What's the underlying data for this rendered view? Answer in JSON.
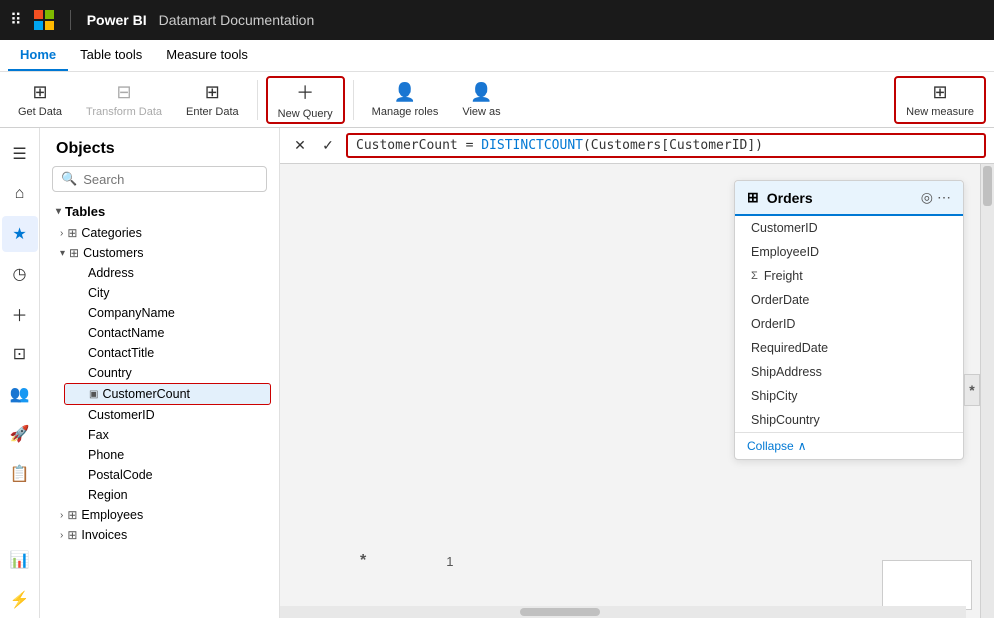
{
  "topbar": {
    "app": "Power BI",
    "title": "Datamart Documentation"
  },
  "ribbon": {
    "tabs": [
      "Home",
      "Table tools",
      "Measure tools"
    ],
    "active_tab": "Home",
    "buttons": [
      {
        "label": "Get Data",
        "icon": "⊞",
        "disabled": false
      },
      {
        "label": "Transform Data",
        "icon": "⊟",
        "disabled": true
      },
      {
        "label": "Enter Data",
        "icon": "⊞",
        "disabled": false
      },
      {
        "label": "New Query",
        "icon": "+",
        "disabled": false,
        "highlighted": true
      },
      {
        "label": "Manage roles",
        "icon": "👤",
        "disabled": false
      },
      {
        "label": "View as",
        "icon": "👤",
        "disabled": false
      },
      {
        "label": "New measure",
        "icon": "⊞",
        "disabled": false,
        "highlighted": true
      }
    ]
  },
  "sidebar": {
    "icons": [
      "≡",
      "🏠",
      "★",
      "◷",
      "+",
      "⊡",
      "👥",
      "🚀",
      "📋",
      "📊",
      "⚡"
    ]
  },
  "objects": {
    "title": "Objects",
    "search_placeholder": "Search",
    "tables_label": "Tables",
    "categories_label": "Categories",
    "customers_label": "Customers",
    "customers_fields": [
      "Address",
      "City",
      "CompanyName",
      "ContactName",
      "ContactTitle",
      "Country"
    ],
    "customer_count_label": "CustomerCount",
    "customers_fields2": [
      "CustomerID",
      "Fax",
      "Phone",
      "PostalCode",
      "Region"
    ],
    "employees_label": "Employees",
    "invoices_label": "Invoices"
  },
  "formula": {
    "expression": "CustomerCount = DISTINCTCOUNT(Customers[CustomerID])"
  },
  "orders_card": {
    "title": "Orders",
    "fields": [
      {
        "name": "CustomerID",
        "sigma": false
      },
      {
        "name": "EmployeeID",
        "sigma": false
      },
      {
        "name": "Freight",
        "sigma": true
      },
      {
        "name": "OrderDate",
        "sigma": false
      },
      {
        "name": "OrderID",
        "sigma": false
      },
      {
        "name": "RequiredDate",
        "sigma": false
      },
      {
        "name": "ShipAddress",
        "sigma": false
      },
      {
        "name": "ShipCity",
        "sigma": false
      },
      {
        "name": "ShipCountry",
        "sigma": false
      }
    ],
    "collapse_label": "Collapse"
  },
  "grid": {
    "asterisk_bottom": "*",
    "number_1": "1",
    "asterisk_side": "*"
  }
}
